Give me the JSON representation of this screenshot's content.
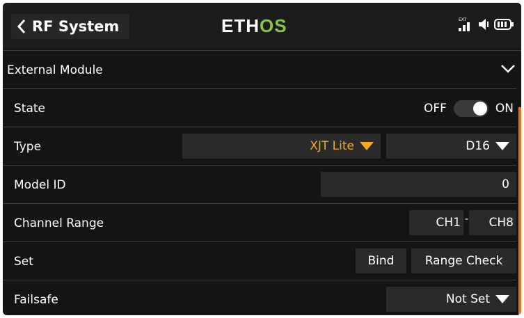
{
  "header": {
    "title": "RF System",
    "logo_part1": "ETH",
    "logo_part2": "OS",
    "ext_label": "EXT"
  },
  "section": {
    "label": "External Module"
  },
  "rows": {
    "state": {
      "label": "State",
      "off": "OFF",
      "on": "ON",
      "value": "ON"
    },
    "type": {
      "label": "Type",
      "protocol": "XJT Lite",
      "mode": "D16"
    },
    "model_id": {
      "label": "Model ID",
      "value": "0"
    },
    "channel_range": {
      "label": "Channel Range",
      "start": "CH1",
      "separator": "-",
      "end": "CH8"
    },
    "set": {
      "label": "Set",
      "bind": "Bind",
      "range_check": "Range Check"
    },
    "failsafe": {
      "label": "Failsafe",
      "value": "Not Set"
    }
  },
  "colors": {
    "accent": "#f5a623",
    "logo_green": "#8bc53f",
    "scrollbar": "#e8761a",
    "background": "#141414"
  },
  "icons": [
    "back-chevron-icon",
    "signal-bars-icon",
    "speaker-icon",
    "battery-icon",
    "chevron-down-icon",
    "dropdown-triangle-icon"
  ]
}
